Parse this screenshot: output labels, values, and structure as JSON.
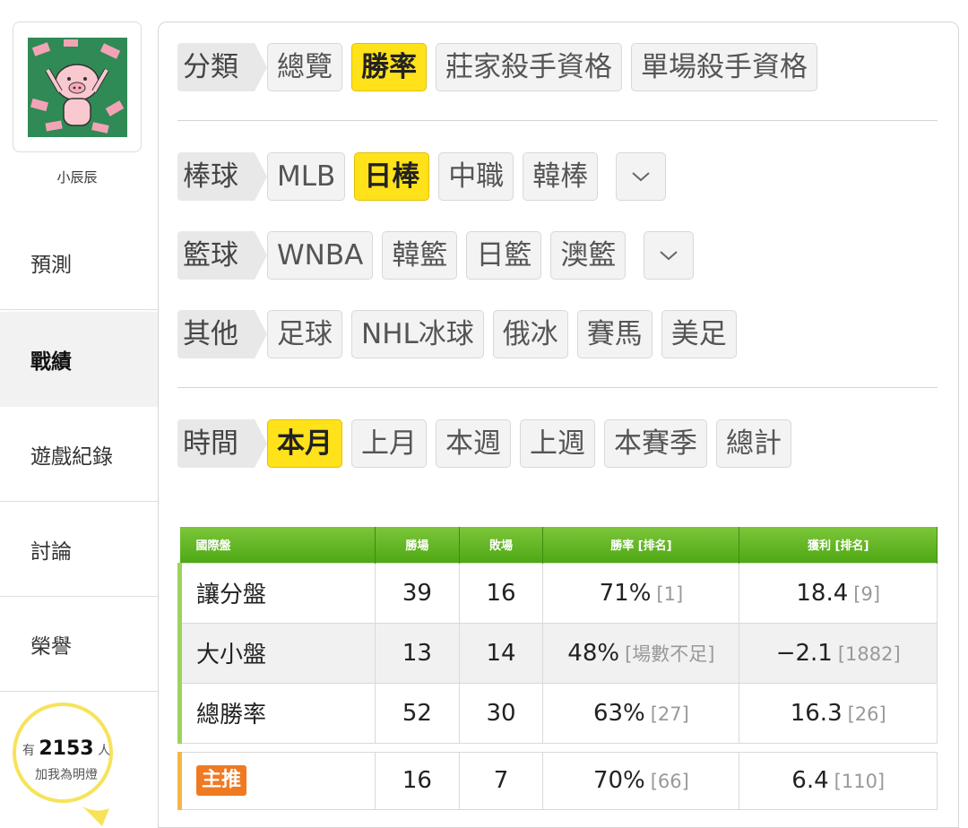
{
  "sidebar": {
    "username": "小辰辰",
    "nav": [
      {
        "label": "預測"
      },
      {
        "label": "戰績"
      },
      {
        "label": "遊戲紀錄"
      },
      {
        "label": "討論"
      },
      {
        "label": "榮譽"
      }
    ],
    "fans": {
      "prefix": "有",
      "count": "2153",
      "suffix": "人",
      "action": "加我為明燈"
    }
  },
  "filters": {
    "category": {
      "label": "分類",
      "options": [
        "總覽",
        "勝率",
        "莊家殺手資格",
        "單場殺手資格"
      ],
      "selected": "勝率"
    },
    "baseball": {
      "label": "棒球",
      "options": [
        "MLB",
        "日棒",
        "中職",
        "韓棒"
      ],
      "selected": "日棒"
    },
    "basketball": {
      "label": "籃球",
      "options": [
        "WNBA",
        "韓籃",
        "日籃",
        "澳籃"
      ],
      "selected": ""
    },
    "other": {
      "label": "其他",
      "options": [
        "足球",
        "NHL冰球",
        "俄冰",
        "賽馬",
        "美足"
      ],
      "selected": ""
    },
    "time": {
      "label": "時間",
      "options": [
        "本月",
        "上月",
        "本週",
        "上週",
        "本賽季",
        "總計"
      ],
      "selected": "本月"
    }
  },
  "table": {
    "headers": [
      "國際盤",
      "勝場",
      "敗場",
      "勝率 [排名]",
      "獲利 [排名]"
    ],
    "rows": [
      {
        "name": "讓分盤",
        "win": "39",
        "loss": "16",
        "rate": "71%",
        "rate_rank": "[1]",
        "profit": "18.4",
        "profit_rank": "[9]"
      },
      {
        "name": "大小盤",
        "win": "13",
        "loss": "14",
        "rate": "48%",
        "rate_rank": "[場數不足]",
        "profit": "−2.1",
        "profit_rank": "[1882]"
      },
      {
        "name": "總勝率",
        "win": "52",
        "loss": "30",
        "rate": "63%",
        "rate_rank": "[27]",
        "profit": "16.3",
        "profit_rank": "[26]"
      }
    ],
    "main_pick": {
      "name": "主推",
      "win": "16",
      "loss": "7",
      "rate": "70%",
      "rate_rank": "[66]",
      "profit": "6.4",
      "profit_rank": "[110]"
    }
  },
  "colors": {
    "selected_chip": "#ffe21a",
    "table_header": "#5bb220",
    "main_tag": "#f07a22",
    "fan_ring": "#f7e35a"
  }
}
